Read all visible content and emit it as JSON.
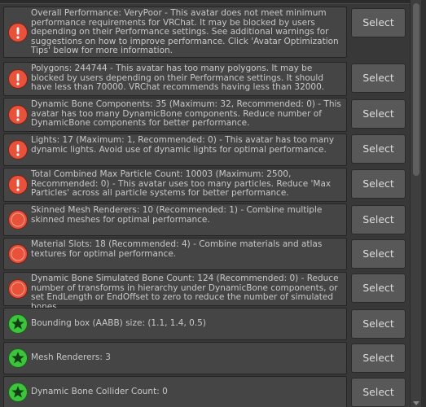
{
  "button_label": "Select",
  "items": [
    {
      "level": "error",
      "icon": "error-icon",
      "text": "Overall Performance: VeryPoor - This avatar does not meet minimum performance requirements for VRChat. It may be blocked by users depending on their Performance settings. See additional warnings for suggestions on how to improve performance. Click 'Avatar Optimization Tips' below for more information."
    },
    {
      "level": "error",
      "icon": "error-icon",
      "text": "Polygons: 244744 - This avatar has too many polygons. It may be blocked by users depending on their Performance settings. It should have less than 70000. VRChat recommends having less than 32000."
    },
    {
      "level": "error",
      "icon": "error-icon",
      "text": "Dynamic Bone Components: 35 (Maximum: 32, Recommended: 0) - This avatar has too many DynamicBone components. Reduce number of DynamicBone components for better performance."
    },
    {
      "level": "error",
      "icon": "error-icon",
      "text": "Lights: 17 (Maximum: 1, Recommended: 0) - This avatar has too many dynamic lights. Avoid use of dynamic lights for optimal performance."
    },
    {
      "level": "error",
      "icon": "error-icon",
      "text": "Total Combined Max Particle Count: 10003 (Maximum: 2500, Recommended: 0) - This avatar uses too many particles. Reduce 'Max Particles' across all particle systems for better performance."
    },
    {
      "level": "warning",
      "icon": "warning-circle-icon",
      "text": "Skinned Mesh Renderers: 10 (Recommended: 1) - Combine multiple skinned meshes for optimal performance."
    },
    {
      "level": "warning",
      "icon": "warning-circle-icon",
      "text": "Material Slots: 18 (Recommended: 4) - Combine materials and atlas textures for optimal performance."
    },
    {
      "level": "warning",
      "icon": "warning-circle-icon",
      "text": "Dynamic Bone Simulated Bone Count: 124 (Recommended: 0) - Reduce number of transforms in hierarchy under DynamicBone components, or set EndLength or EndOffset to zero to reduce the number of simulated bones."
    },
    {
      "level": "good",
      "icon": "star-icon",
      "text": "Bounding box (AABB) size: (1.1, 1.4, 0.5)"
    },
    {
      "level": "good",
      "icon": "star-icon",
      "text": "Mesh Renderers: 3"
    },
    {
      "level": "good",
      "icon": "star-icon",
      "text": "Dynamic Bone Collider Count: 0"
    }
  ],
  "colors": {
    "error": "#e8513a",
    "warning": "#e8513a",
    "good": "#3cc43c"
  }
}
